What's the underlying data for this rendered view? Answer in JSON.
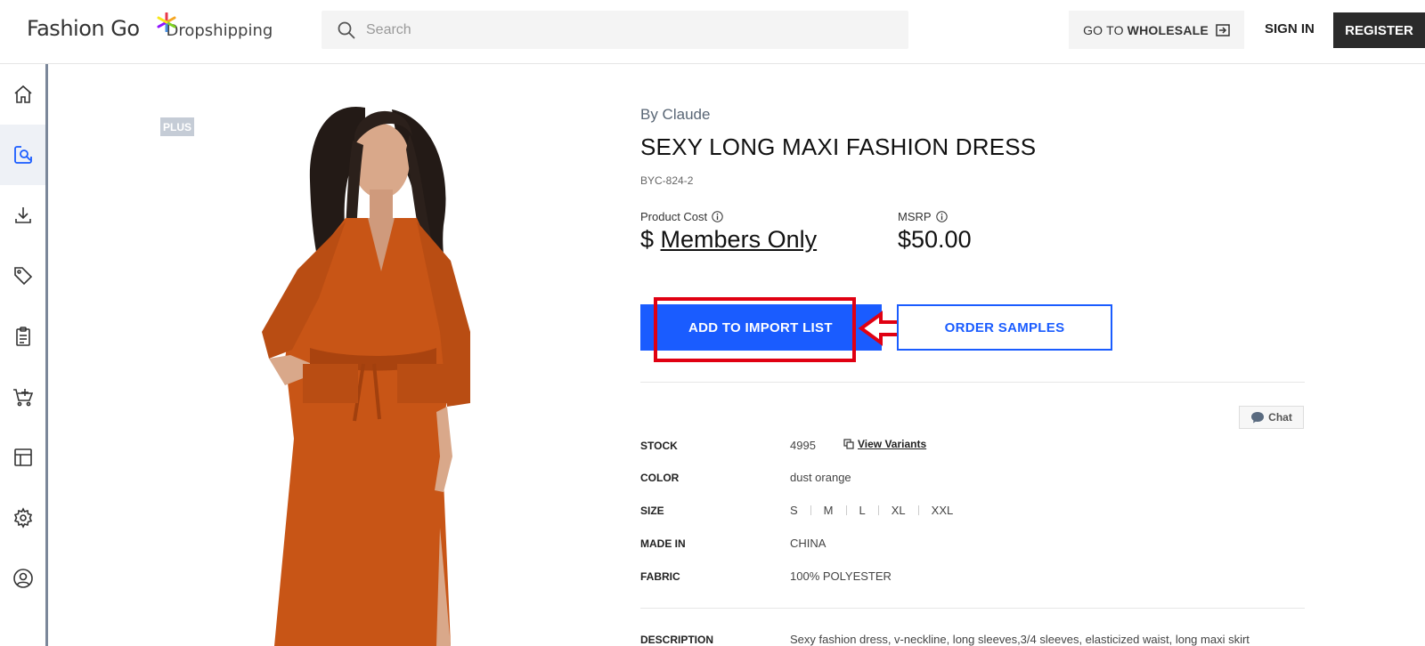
{
  "header": {
    "logo_main": "Fashion Go",
    "logo_sub": "Dropshipping",
    "search_placeholder": "Search",
    "wholesale_prefix": "GO TO",
    "wholesale_bold": "WHOLESALE",
    "signin_label": "SIGN IN",
    "register_label": "REGISTER"
  },
  "sidebar": {
    "items": [
      {
        "icon": "home-icon",
        "active": false
      },
      {
        "icon": "search-products-icon",
        "active": true
      },
      {
        "icon": "download-icon",
        "active": false
      },
      {
        "icon": "tag-icon",
        "active": false
      },
      {
        "icon": "clipboard-icon",
        "active": false
      },
      {
        "icon": "cart-icon",
        "active": false
      },
      {
        "icon": "layout-icon",
        "active": false
      },
      {
        "icon": "gear-icon",
        "active": false
      },
      {
        "icon": "user-icon",
        "active": false
      }
    ]
  },
  "product": {
    "badge": "PLUS",
    "brand": "By Claude",
    "title": "SEXY LONG MAXI FASHION DRESS",
    "sku": "BYC-824-2",
    "product_cost_label": "Product Cost",
    "price_currency": "$",
    "price_members": "Members Only",
    "msrp_label": "MSRP",
    "msrp_value": "$50.00",
    "add_button": "ADD TO IMPORT LIST",
    "order_button": "ORDER SAMPLES",
    "chat_label": "Chat",
    "specs": {
      "stock_label": "STOCK",
      "stock_value": "4995",
      "variants_link": "View Variants",
      "color_label": "COLOR",
      "color_value": "dust orange",
      "size_label": "SIZE",
      "sizes": [
        "S",
        "M",
        "L",
        "XL",
        "XXL"
      ],
      "made_in_label": "MADE IN",
      "made_in_value": "CHINA",
      "fabric_label": "FABRIC",
      "fabric_value": "100% POLYESTER",
      "description_label": "DESCRIPTION",
      "description_value": "Sexy fashion dress, v-neckline, long sleeves,3/4 sleeves, elasticized waist, long maxi skirt"
    }
  },
  "colors": {
    "primary_blue": "#1a5cff",
    "highlight_red": "#e00012",
    "dress_orange": "#c85516"
  }
}
